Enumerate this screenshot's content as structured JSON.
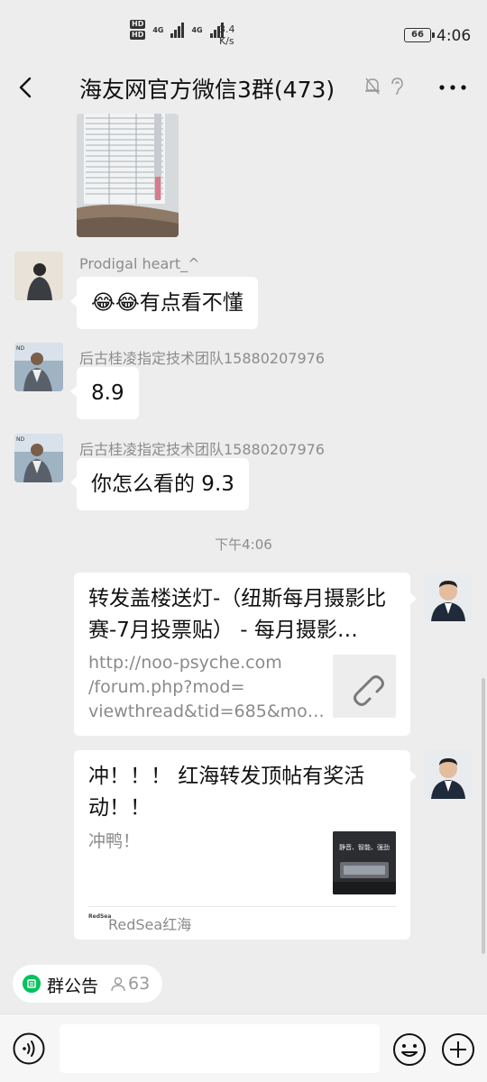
{
  "status_bar": {
    "hd_top": "HD",
    "hd_bottom": "HD",
    "net_a": "4G",
    "net_b": "4G",
    "speed_value": "3.4",
    "speed_unit": "K/s",
    "battery": "66",
    "time": "4:06"
  },
  "header": {
    "title": "海友网官方微信3群(473)"
  },
  "messages": [
    {
      "sender": "Prodigal heart_^",
      "text": "😂😂有点看不懂"
    },
    {
      "sender": "后古桂凌指定技术团队15880207976",
      "text": "8.9"
    },
    {
      "sender": "后古桂凌指定技术团队15880207976",
      "text": "你怎么看的 9.3"
    }
  ],
  "time_separator": "下午4:06",
  "card1": {
    "title": "转发盖楼送灯-（纽斯每月摄影比赛-7月投票贴） - 每月摄影…",
    "url": "http://noo-psyche.com\n/forum.php?mod=\nviewthread&tid=685&mo…"
  },
  "card2": {
    "title": "冲！！！ 红海转发顶帖有奖活动！！",
    "desc": "冲鸭！",
    "thumb_text": "静音、智能、强劲",
    "source": "RedSea红海",
    "source_logo": "RedSea"
  },
  "bottom": {
    "notice_label": "群公告",
    "member_count": "63",
    "input_placeholder": ""
  }
}
